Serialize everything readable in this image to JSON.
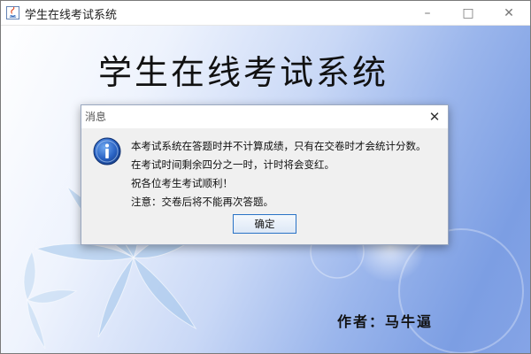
{
  "window": {
    "title": "学生在线考试系统",
    "icon": "java-icon",
    "controls": {
      "minimize": "–",
      "maximize": "□",
      "close": "✕"
    }
  },
  "main": {
    "heading": "学生在线考试系统",
    "author": "作者：马牛逼"
  },
  "dialog": {
    "title": "消息",
    "close": "✕",
    "icon": "info-icon",
    "lines": [
      "本考试系统在答题时并不计算成绩，只有在交卷时才会统计分数。",
      "在考试时间剩余四分之一时，计时将会变红。",
      "祝各位考生考试顺利！",
      "注意：交卷后将不能再次答题。"
    ],
    "ok_label": "确定"
  }
}
